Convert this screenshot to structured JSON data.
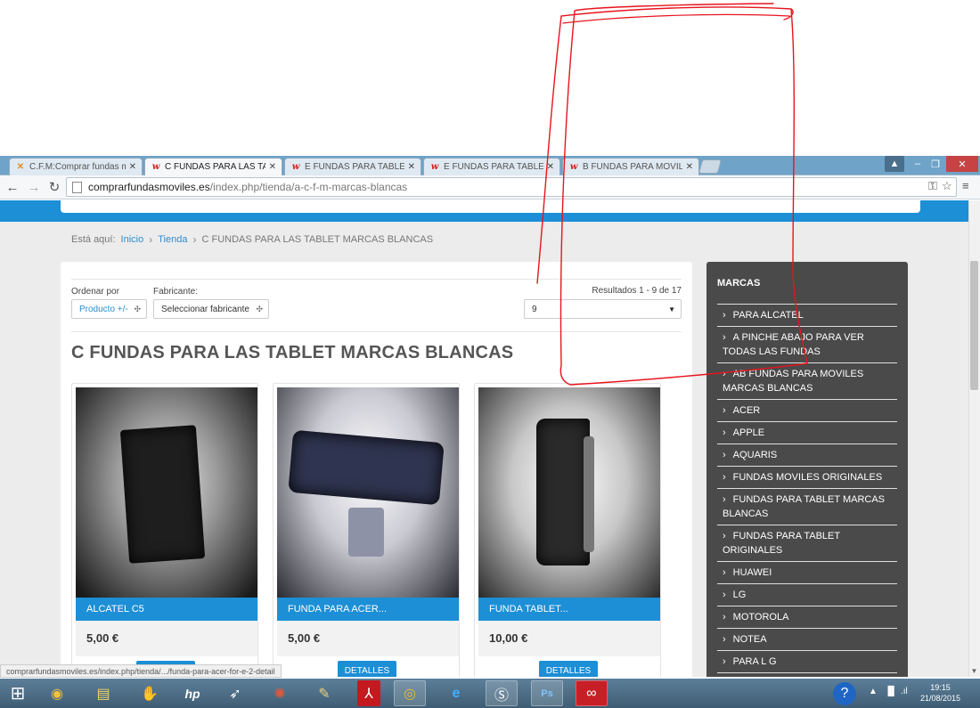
{
  "browser": {
    "tabs": [
      {
        "label": "C.F.M:Comprar fundas mo",
        "favicon": "joomla-icon"
      },
      {
        "label": "C FUNDAS PARA LAS TAB",
        "favicon": "w-icon"
      },
      {
        "label": "E FUNDAS PARA TABLET (",
        "favicon": "w-icon"
      },
      {
        "label": "E FUNDAS PARA TABLET (",
        "favicon": "w-icon"
      },
      {
        "label": "B FUNDAS PARA MOVILE:",
        "favicon": "w-icon"
      }
    ],
    "url_host": "comprarfundasmoviles.es",
    "url_path": "/index.php/tienda/a-c-f-m-marcas-blancas",
    "status_url": "comprarfundasmoviles.es/index.php/tienda/.../funda-para-acer-for-e-2-detail"
  },
  "breadcrumb": {
    "prefix": "Está aquí:",
    "items": [
      "Inicio",
      "Tienda",
      "C FUNDAS PARA LAS TABLET MARCAS BLANCAS"
    ]
  },
  "filters": {
    "order_label": "Ordenar por",
    "order_value": "Producto +/-",
    "maker_label": "Fabricante:",
    "maker_value": "Seleccionar fabricante",
    "results_text": "Resultados 1 - 9 de 17",
    "per_page": "9"
  },
  "page_title": "C FUNDAS PARA LAS TABLET MARCAS BLANCAS",
  "products": [
    {
      "name": "ALCATEL C5",
      "price": "5,00 €",
      "button": ""
    },
    {
      "name": "FUNDA PARA ACER...",
      "price": "5,00 €",
      "button": "DETALLES"
    },
    {
      "name": "FUNDA TABLET...",
      "price": "10,00 €",
      "button": "DETALLES"
    }
  ],
  "sidebar": {
    "heading": "MARCAS",
    "items": [
      "PARA ALCATEL",
      "A PINCHE ABAJO PARA VER TODAS LAS FUNDAS",
      "AB FUNDAS PARA MOVILES MARCAS BLANCAS",
      "ACER",
      "APPLE",
      "AQUARIS",
      "FUNDAS MOVILES ORIGINALES",
      "FUNDAS PARA TABLET MARCAS BLANCAS",
      "FUNDAS PARA TABLET ORIGINALES",
      "HUAWEI",
      "LG",
      "MOTOROLA",
      "NOTEA",
      "PARA L G"
    ]
  },
  "taskbar": {
    "time": "19:15",
    "date": "21/08/2015",
    "apps": [
      "start-icon",
      "media-icon",
      "file-explorer-icon",
      "hand-icon",
      "hp-icon",
      "rocket-icon",
      "paint-icon",
      "palette-icon",
      "adobe-reader-icon",
      "chrome-icon",
      "internet-explorer-icon",
      "skype-icon",
      "photoshop-icon",
      "creative-cloud-icon"
    ]
  },
  "colors": {
    "accent": "#1c8fd6",
    "sidebar_bg": "#4a4a4a",
    "annotation": "#e8141e"
  }
}
